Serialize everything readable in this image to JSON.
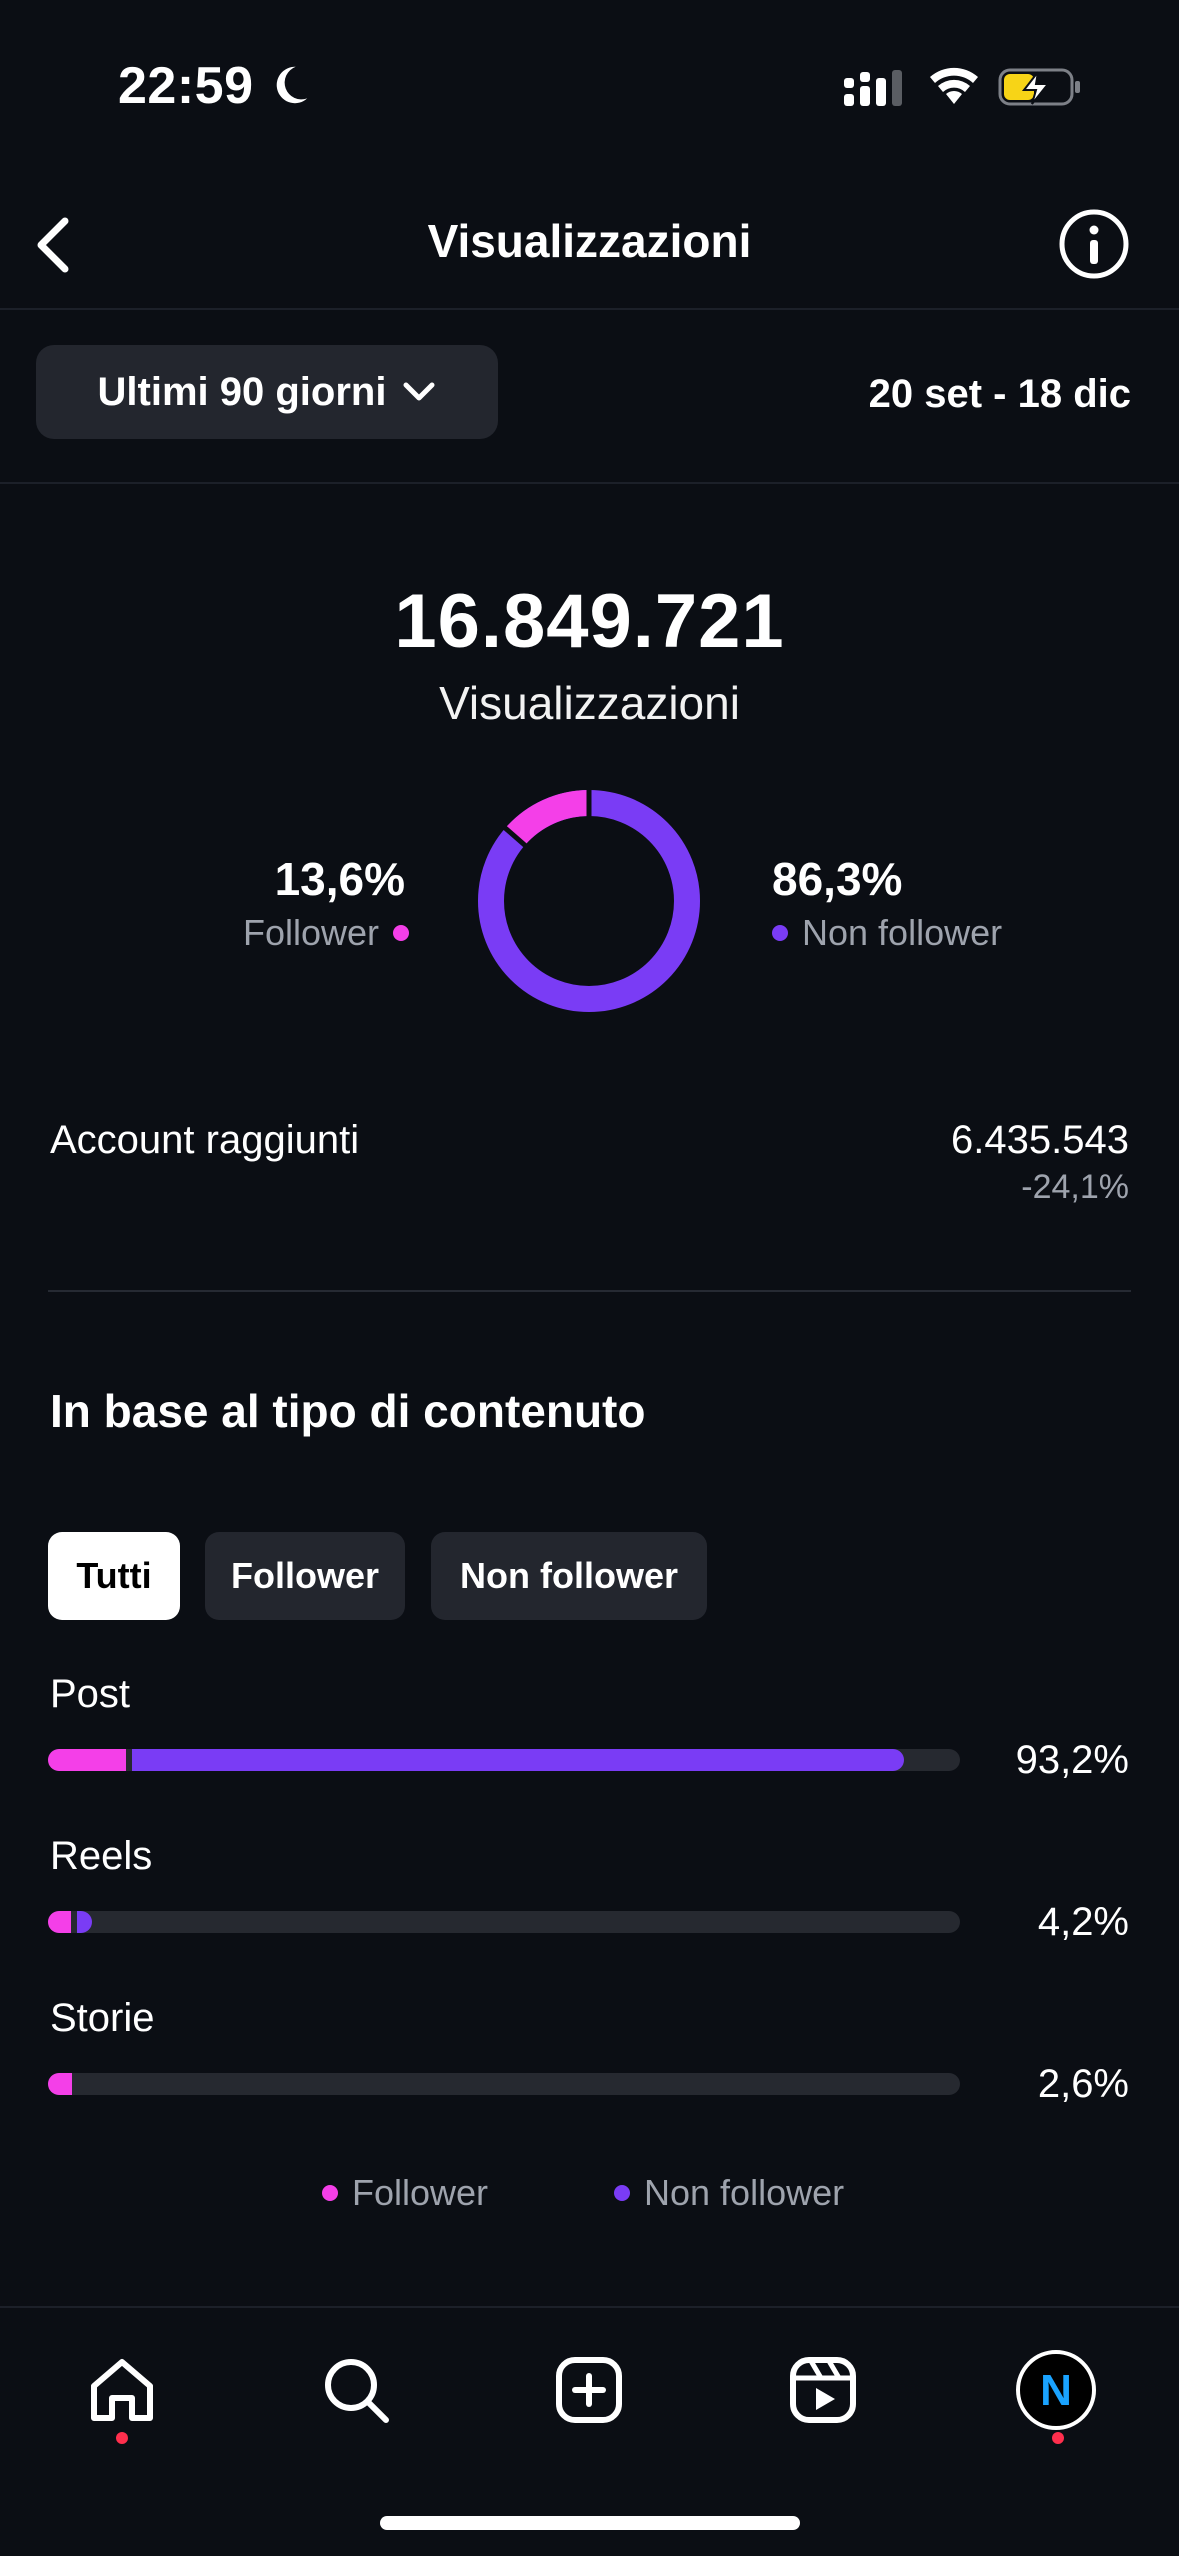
{
  "status_bar": {
    "time": "22:59"
  },
  "header": {
    "title": "Visualizzazioni"
  },
  "period": {
    "selected": "Ultimi 90 giorni",
    "date_range": "20 set - 18 dic"
  },
  "summary": {
    "total": "16.849.721",
    "label": "Visualizzazioni",
    "follower_pct": "13,6%",
    "follower_label": "Follower",
    "nonfollower_pct": "86,3%",
    "nonfollower_label": "Non follower"
  },
  "reach": {
    "label": "Account raggiunti",
    "value": "6.435.543",
    "change": "-24,1%"
  },
  "content_section": {
    "title": "In base al tipo di contenuto",
    "filters": [
      "Tutti",
      "Follower",
      "Non follower"
    ],
    "rows": [
      {
        "label": "Post",
        "pct": "93,2%",
        "follower_share": 8.6,
        "nonfollower_share": 84.6
      },
      {
        "label": "Reels",
        "pct": "4,2%",
        "follower_share": 2.5,
        "nonfollower_share": 1.7
      },
      {
        "label": "Storie",
        "pct": "2,6%",
        "follower_share": 2.6,
        "nonfollower_share": 0
      }
    ],
    "legend": [
      "Follower",
      "Non follower"
    ]
  },
  "colors": {
    "follower": "#f43fe8",
    "nonfollower": "#7a3cf5",
    "background": "#0b0e14"
  },
  "nav": {
    "items": [
      "home-icon",
      "search-icon",
      "create-icon",
      "reels-icon",
      "profile-avatar"
    ],
    "avatar_letter": "N"
  }
}
